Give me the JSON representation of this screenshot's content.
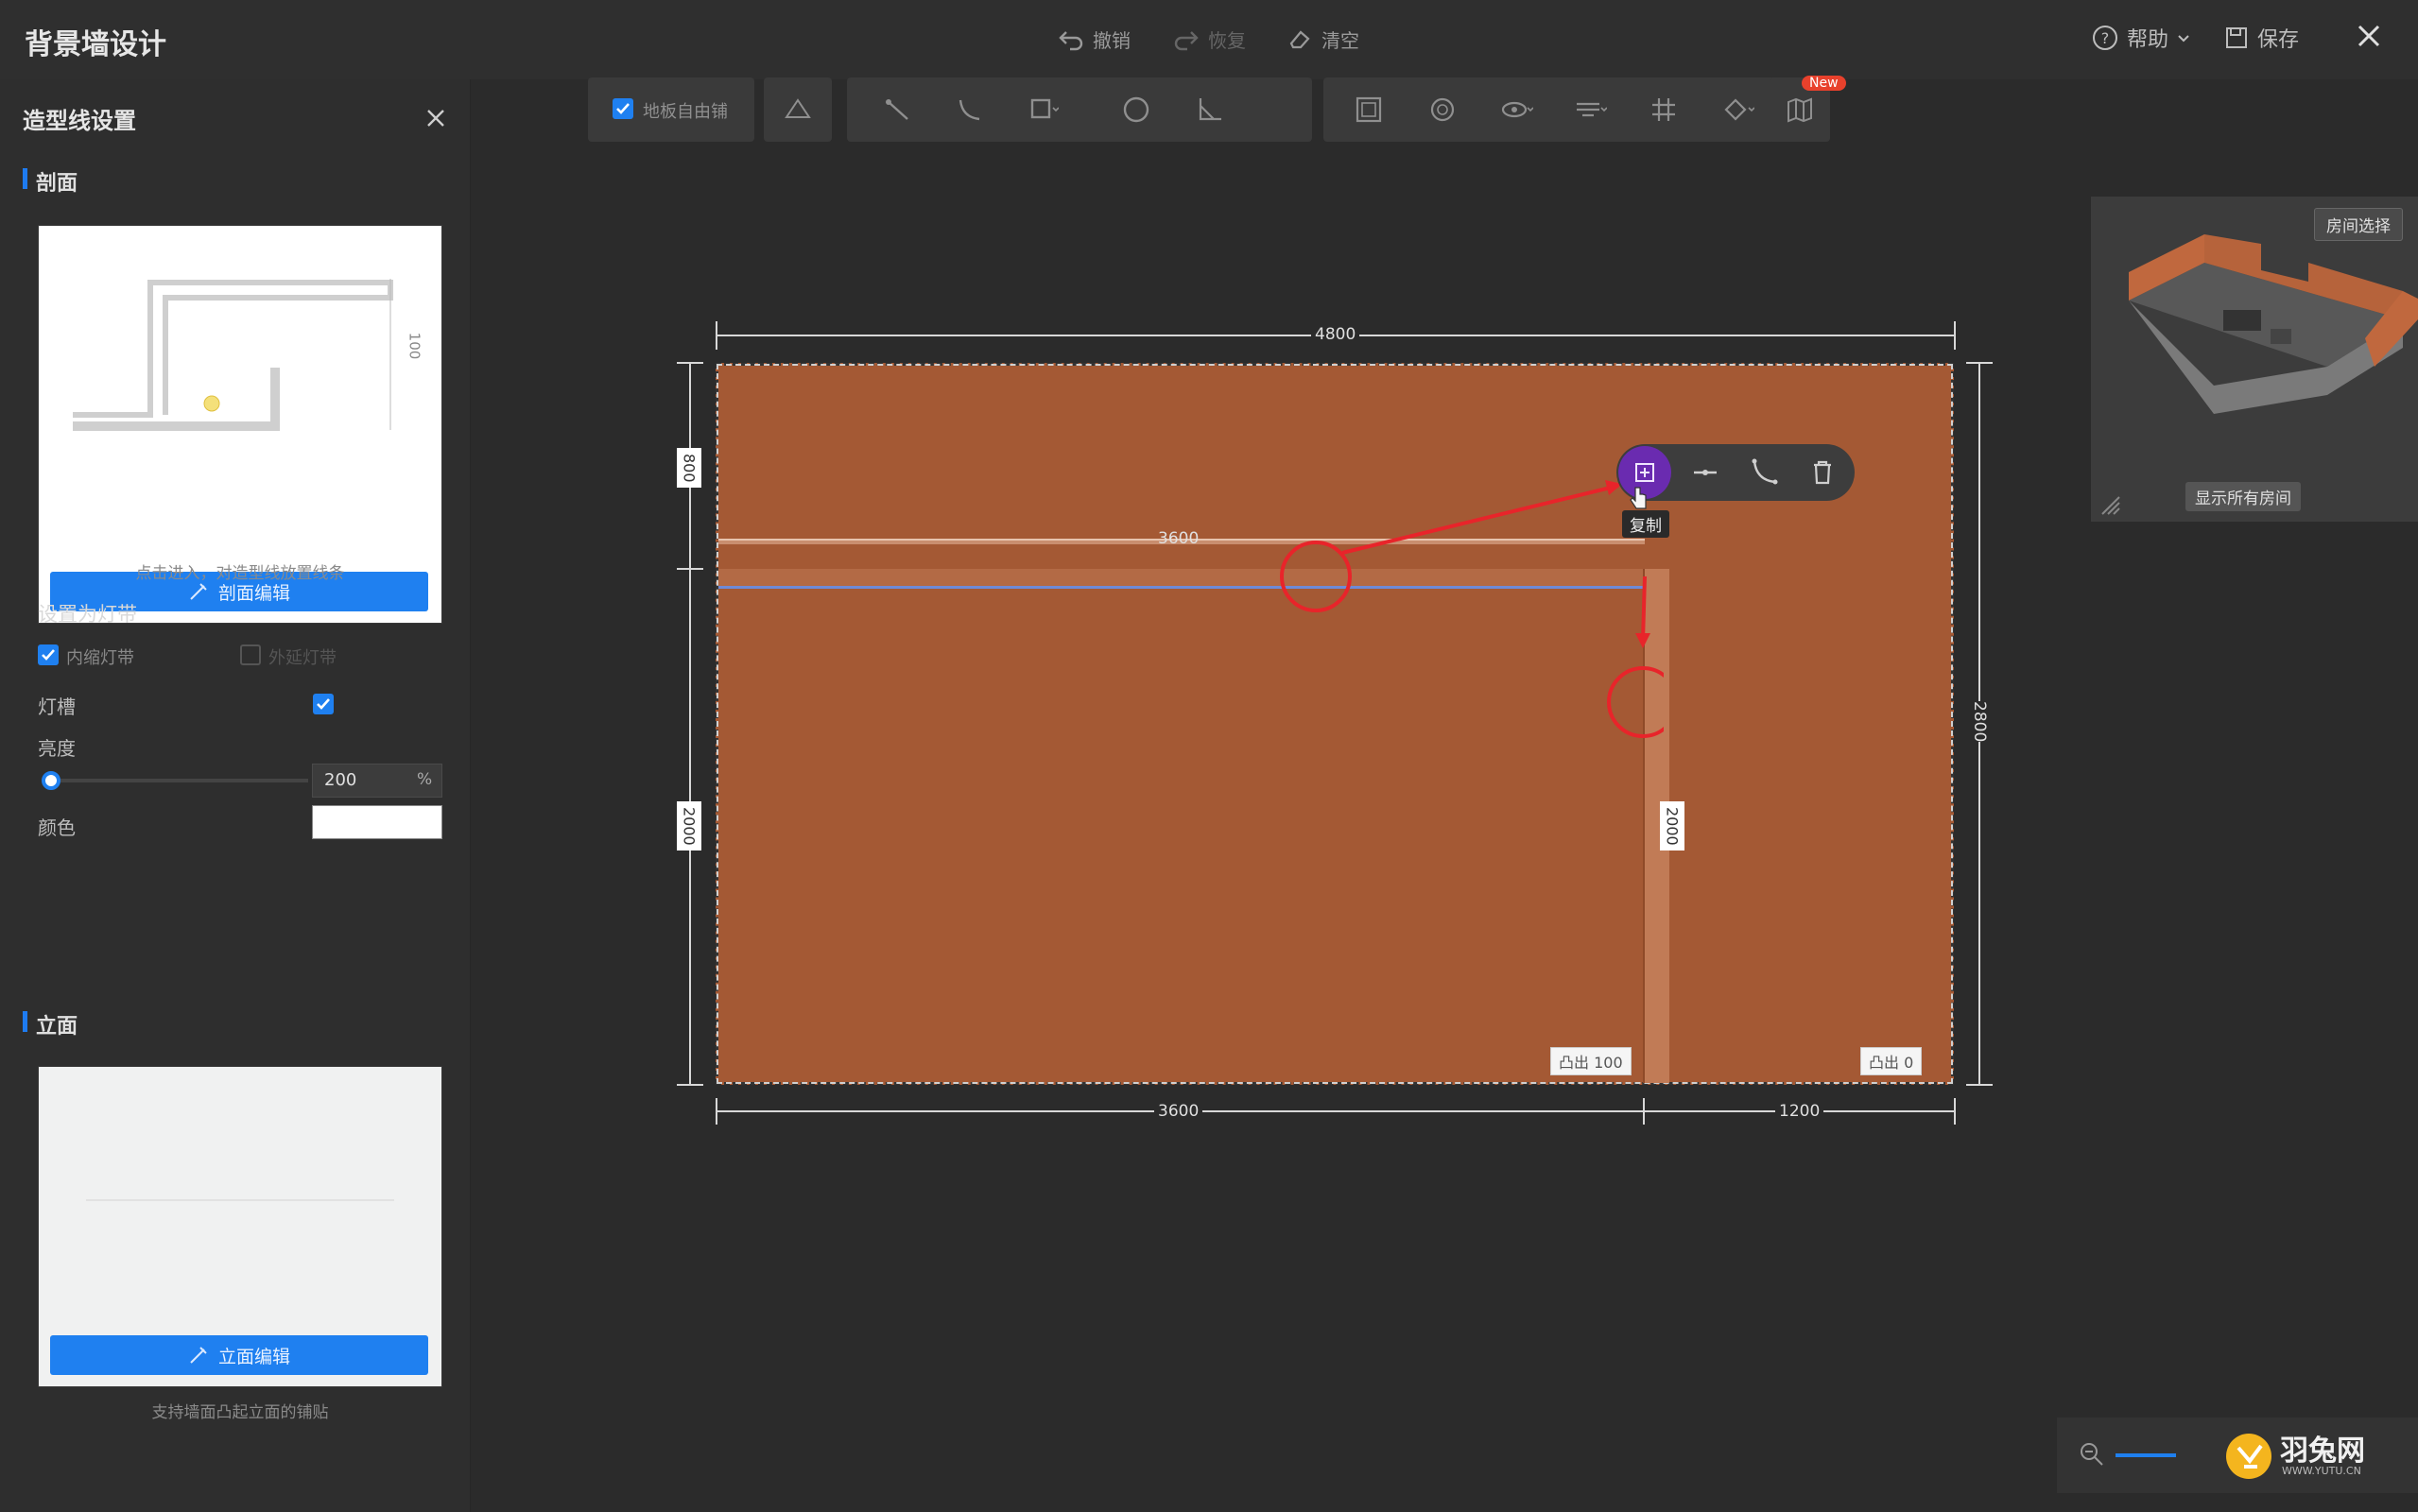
{
  "app": {
    "title": "背景墙设计"
  },
  "history": {
    "undo": "撤销",
    "redo": "恢复",
    "clear": "清空"
  },
  "topright": {
    "help": "帮助",
    "save": "保存"
  },
  "panel": {
    "title": "造型线设置",
    "section_profile": "剖面",
    "profile_dim": "100",
    "profile_edit_btn": "剖面编辑",
    "profile_note": "点击进入，对造型线放置线条",
    "lightstrip_title": "设置为灯带",
    "inner_strip": "内缩灯带",
    "outer_strip": "外延灯带",
    "lamp_slot": "灯槽",
    "brightness": "亮度",
    "brightness_value": "200",
    "brightness_unit": "%",
    "color": "颜色",
    "section_elevation": "立面",
    "elevation_edit_btn": "立面编辑",
    "elevation_note": "支持墙面凸起立面的铺贴"
  },
  "toolbar": {
    "free_paving": "地板自由铺",
    "new_badge": "New",
    "icons": [
      "wall-icon",
      "line-icon",
      "arc-icon",
      "rect-icon",
      "circle-icon",
      "polyline-icon",
      "frame-icon",
      "offset-icon",
      "view-icon",
      "align-icon",
      "grid-icon",
      "material-icon",
      "map-icon"
    ]
  },
  "canvas": {
    "dim_top": "4800",
    "dim_right": "2800",
    "dim_left_top": "800",
    "dim_left_bottom": "2000",
    "dim_line": "3600",
    "dim_inner": "2000",
    "dim_bottom_left": "3600",
    "dim_bottom_right": "1200",
    "tag_left_label": "凸出",
    "tag_left_value": "100",
    "tag_right_label": "凸出",
    "tag_right_value": "0",
    "wall_color": "#a45934",
    "copy_tooltip": "复制"
  },
  "preview": {
    "room_select": "房间选择",
    "show_all_rooms": "显示所有房间"
  },
  "brand": {
    "name": "羽兔网",
    "url": "WWW.YUTU.CN"
  }
}
